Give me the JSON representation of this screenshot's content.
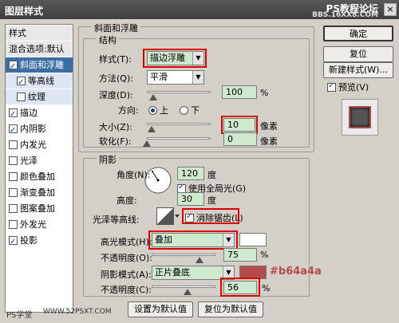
{
  "window": {
    "title": "图层样式",
    "watermark_top": "PS教程论坛",
    "watermark_top2": "BBS.16XX8.COM",
    "close_glyph": "×"
  },
  "left_panel": {
    "items": [
      {
        "label": "样式",
        "checked": null,
        "selected": false,
        "kind": "header"
      },
      {
        "label": "混合选项:默认",
        "checked": null,
        "selected": false,
        "kind": "header"
      },
      {
        "label": "斜面和浮雕",
        "checked": true,
        "selected": true,
        "kind": "item"
      },
      {
        "label": "等高线",
        "checked": true,
        "selected": false,
        "kind": "sub"
      },
      {
        "label": "纹理",
        "checked": false,
        "selected": false,
        "kind": "sub"
      },
      {
        "label": "描边",
        "checked": true,
        "selected": false,
        "kind": "item"
      },
      {
        "label": "内阴影",
        "checked": true,
        "selected": false,
        "kind": "item"
      },
      {
        "label": "内发光",
        "checked": false,
        "selected": false,
        "kind": "item"
      },
      {
        "label": "光泽",
        "checked": false,
        "selected": false,
        "kind": "item"
      },
      {
        "label": "颜色叠加",
        "checked": false,
        "selected": false,
        "kind": "item"
      },
      {
        "label": "渐变叠加",
        "checked": false,
        "selected": false,
        "kind": "item"
      },
      {
        "label": "图案叠加",
        "checked": false,
        "selected": false,
        "kind": "item"
      },
      {
        "label": "外发光",
        "checked": false,
        "selected": false,
        "kind": "item"
      },
      {
        "label": "投影",
        "checked": true,
        "selected": false,
        "kind": "item"
      }
    ]
  },
  "bevel": {
    "section_title": "斜面和浮雕",
    "structure_title": "结构",
    "style_label": "样式(T):",
    "style_value": "描边浮雕",
    "technique_label": "方法(Q):",
    "technique_value": "平滑",
    "depth_label": "深度(D):",
    "depth_value": "100",
    "depth_slider": 0.1,
    "depth_unit": "%",
    "direction_label": "方向:",
    "direction_up": "上",
    "direction_down": "下",
    "size_label": "大小(Z):",
    "size_value": "10",
    "size_slider": 0.07,
    "size_unit": "像素",
    "soften_label": "软化(F):",
    "soften_value": "0",
    "soften_slider": 0.0,
    "soften_unit": "像素"
  },
  "shading": {
    "title": "阴影",
    "angle_label": "角度(N):",
    "angle_value": "120",
    "angle_unit": "度",
    "global_light_label": "使用全局光(G)",
    "altitude_label": "高度:",
    "altitude_value": "30",
    "altitude_unit": "度",
    "gloss_contour_label": "光泽等高线:",
    "anti_alias_label": "消除锯齿(L)",
    "highlight_mode_label": "高光模式(H):",
    "highlight_mode_value": "叠加",
    "highlight_color": "#ffffff",
    "highlight_opacity_label": "不透明度(O):",
    "highlight_opacity_value": "75",
    "highlight_opacity_slider": 0.75,
    "shadow_mode_label": "阴影模式(A):",
    "shadow_mode_value": "正片叠底",
    "shadow_color": "#b64a4a",
    "shadow_opacity_label": "不透明度(C):",
    "shadow_opacity_value": "56",
    "shadow_opacity_slider": 0.56,
    "pct": "%"
  },
  "bottom_buttons": {
    "make_default": "设置为默认值",
    "reset_default": "复位为默认值"
  },
  "right_panel": {
    "ok": "确定",
    "reset": "复位",
    "new_style": "新建样式(W)...",
    "preview_label": "预览(V)",
    "preview_color": "#b64a4a"
  },
  "annotation": {
    "color_note": "#b64a4a"
  },
  "watermark_bottom": {
    "left": "PS学堂",
    "url": "WWW.52PSXT.COM"
  }
}
